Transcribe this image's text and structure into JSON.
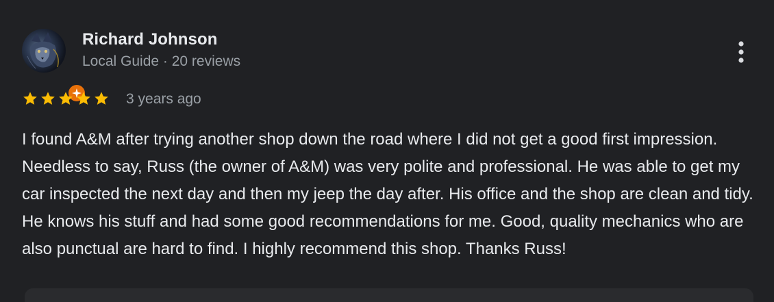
{
  "review": {
    "author_name": "Richard Johnson",
    "author_meta": "Local Guide · 20 reviews",
    "rating": 5,
    "rating_max": 5,
    "date": "3 years ago",
    "text": "I found A&M after trying another shop down the road where I did not get a good first impression. Needless to say, Russ (the owner of A&M) was very polite and professional. He was able to get my car inspected the next day and then my jeep the day after. His office and the shop are clean and tidy. He knows his stuff and had some good recommendations for me. Good, quality mechanics who are also punctual are hard to find. I highly recommend this shop. Thanks Russ!"
  },
  "icons": {
    "avatar": "wolf-portrait-avatar",
    "badge": "local-guide-badge-icon",
    "menu": "more-vert-icon",
    "star": "star-icon"
  },
  "colors": {
    "background": "#202124",
    "star": "#fbbc04",
    "badge": "#e8710a",
    "primary_text": "#e8eaed",
    "secondary_text": "#9aa0a6"
  }
}
